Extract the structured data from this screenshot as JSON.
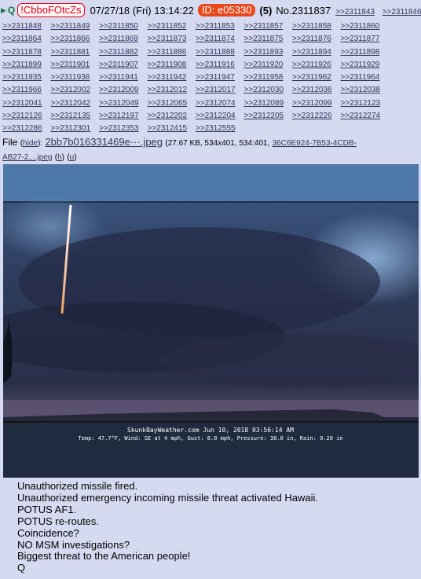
{
  "header": {
    "arrow_glyph": "▶",
    "q_letter": "Q",
    "tripcode": "!CbboFOtcZs",
    "datetime": "07/27/18 (Fri) 13:14:22",
    "id_badge": "ID: e05330",
    "post_count": "(5)",
    "post_number": "No.2311837",
    "quotes": [
      ">>2311843",
      ">>2311846"
    ]
  },
  "quote_lines": [
    [
      ">>2311848",
      ">>2311849",
      ">>2311850",
      ">>2311852",
      ">>2311853",
      ">>2311857",
      ">>2311858",
      ">>2311860"
    ],
    [
      ">>2311864",
      ">>2311866",
      ">>2311869",
      ">>2311873",
      ">>2311874",
      ">>2311875",
      ">>2311876",
      ">>2311877"
    ],
    [
      ">>2311878",
      ">>2311881",
      ">>2311882",
      ">>2311886",
      ">>2311888",
      ">>2311893",
      ">>2311894",
      ">>2311898"
    ],
    [
      ">>2311899",
      ">>2311901",
      ">>2311907",
      ">>2311908",
      ">>2311916",
      ">>2311920",
      ">>2311926",
      ">>2311929"
    ],
    [
      ">>2311935",
      ">>2311938",
      ">>2311941",
      ">>2311942",
      ">>2311947",
      ">>2311958",
      ">>2311962",
      ">>2311964"
    ],
    [
      ">>2311966",
      ">>2312002",
      ">>2312009",
      ">>2312012",
      ">>2312017",
      ">>2312030",
      ">>2312036",
      ">>2312038"
    ],
    [
      ">>2312041",
      ">>2312042",
      ">>2312049",
      ">>2312065",
      ">>2312074",
      ">>2312089",
      ">>2312099",
      ">>2312123"
    ],
    [
      ">>2312126",
      ">>2312135",
      ">>2312197",
      ">>2312202",
      ">>2312204",
      ">>2312205",
      ">>2312226",
      ">>2312274"
    ],
    [
      ">>2312286",
      ">>2312301",
      ">>2312353",
      ">>2312415",
      ">>2312555"
    ]
  ],
  "file": {
    "label": "File",
    "hide_link": "hide",
    "filename": "2bb7b016331469e···.jpeg",
    "meta": "(27.67 KB, 534x401, 534:401,",
    "hash_link": "36C6E924-7B53-4CDB-",
    "hash_link2": "AB27-2....jpeg",
    "h_link": "h",
    "u_link": "u"
  },
  "image": {
    "overlay_line1": "SkunkBayWeather.com  Jun 10, 2018  03:56:14 AM",
    "overlay_line2": "Temp:  47.7°F, Wind: SE  at    4 mph, Gust:  8.0 mph, Pressure:  30.0 in, Rain: 0.20 in"
  },
  "body_lines": [
    "Unauthorized missile fired.",
    "Unauthorized emergency incoming missile threat activated Hawaii.",
    "POTUS AF1.",
    "POTUS re-routes.",
    "Coincidence?",
    "NO MSM investigations?",
    "Biggest threat to the American people!",
    "Q"
  ],
  "colors": {
    "background": "#d6daf0",
    "link": "#34345c",
    "trip": "#e8001c",
    "id_badge": "#e8491c",
    "q_green": "#117743"
  }
}
